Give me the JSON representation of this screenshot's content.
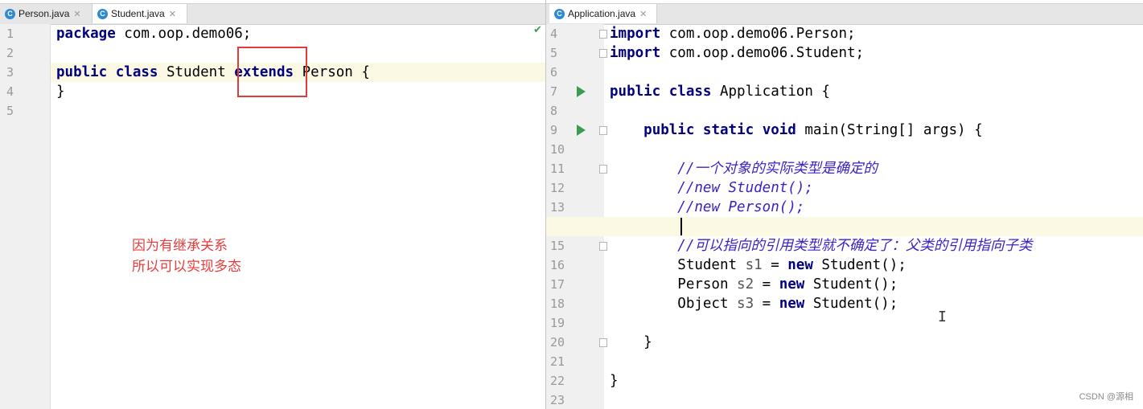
{
  "left_editor": {
    "tabs": [
      {
        "label": "Person.java",
        "icon": "C",
        "active": false
      },
      {
        "label": "Student.java",
        "icon": "C",
        "active": true
      }
    ],
    "lines": [
      {
        "num": "1",
        "parts": [
          {
            "t": "package",
            "c": "kw"
          },
          {
            "t": " com.oop.demo06;",
            "c": "code"
          }
        ]
      },
      {
        "num": "2",
        "parts": []
      },
      {
        "num": "3",
        "highlight": true,
        "parts": [
          {
            "t": "public",
            "c": "kw"
          },
          {
            "t": " ",
            "c": "code"
          },
          {
            "t": "class",
            "c": "kw"
          },
          {
            "t": " Student ",
            "c": "code"
          },
          {
            "t": "extends",
            "c": "kw"
          },
          {
            "t": " Person {",
            "c": "code"
          }
        ]
      },
      {
        "num": "4",
        "parts": [
          {
            "t": "}",
            "c": "code"
          }
        ]
      },
      {
        "num": "5",
        "parts": []
      }
    ],
    "annotation": [
      "因为有继承关系",
      "所以可以实现多态"
    ]
  },
  "right_editor": {
    "tabs": [
      {
        "label": "Application.java",
        "icon": "C",
        "active": true
      }
    ],
    "lines": [
      {
        "num": "4",
        "fold": true,
        "parts": [
          {
            "t": "import",
            "c": "kw"
          },
          {
            "t": " com.oop.demo06.Person;",
            "c": "code"
          }
        ]
      },
      {
        "num": "5",
        "fold": true,
        "parts": [
          {
            "t": "import",
            "c": "kw"
          },
          {
            "t": " com.oop.demo06.Student;",
            "c": "code"
          }
        ]
      },
      {
        "num": "6",
        "parts": []
      },
      {
        "num": "7",
        "run": true,
        "parts": [
          {
            "t": "public",
            "c": "kw"
          },
          {
            "t": " ",
            "c": "code"
          },
          {
            "t": "class",
            "c": "kw"
          },
          {
            "t": " Application {",
            "c": "code"
          }
        ]
      },
      {
        "num": "8",
        "parts": []
      },
      {
        "num": "9",
        "run": true,
        "fold": true,
        "parts": [
          {
            "t": "    ",
            "c": "code"
          },
          {
            "t": "public",
            "c": "kw"
          },
          {
            "t": " ",
            "c": "code"
          },
          {
            "t": "static",
            "c": "kw"
          },
          {
            "t": " ",
            "c": "code"
          },
          {
            "t": "void",
            "c": "kw"
          },
          {
            "t": " main(String[] args) {",
            "c": "code"
          }
        ]
      },
      {
        "num": "10",
        "parts": []
      },
      {
        "num": "11",
        "fold": true,
        "parts": [
          {
            "t": "        ",
            "c": "code"
          },
          {
            "t": "//一个对象的实际类型是确定的",
            "c": "cmt"
          }
        ]
      },
      {
        "num": "12",
        "parts": [
          {
            "t": "        ",
            "c": "code"
          },
          {
            "t": "//new Student();",
            "c": "cmt"
          }
        ]
      },
      {
        "num": "13",
        "parts": [
          {
            "t": "        ",
            "c": "code"
          },
          {
            "t": "//new Person();",
            "c": "cmt"
          }
        ]
      },
      {
        "num": "14",
        "highlight": true,
        "parts": []
      },
      {
        "num": "15",
        "fold": true,
        "parts": [
          {
            "t": "        ",
            "c": "code"
          },
          {
            "t": "//可以指向的引用类型就不确定了：父类的引用指向子类",
            "c": "cmt"
          }
        ]
      },
      {
        "num": "16",
        "parts": [
          {
            "t": "        Student ",
            "c": "code"
          },
          {
            "t": "s1",
            "c": "varn"
          },
          {
            "t": " = ",
            "c": "code"
          },
          {
            "t": "new",
            "c": "kw"
          },
          {
            "t": " Student();",
            "c": "code"
          }
        ]
      },
      {
        "num": "17",
        "parts": [
          {
            "t": "        Person ",
            "c": "code"
          },
          {
            "t": "s2",
            "c": "varn"
          },
          {
            "t": " = ",
            "c": "code"
          },
          {
            "t": "new",
            "c": "kw"
          },
          {
            "t": " Student();",
            "c": "code"
          }
        ]
      },
      {
        "num": "18",
        "parts": [
          {
            "t": "        Object ",
            "c": "code"
          },
          {
            "t": "s3",
            "c": "varn"
          },
          {
            "t": " = ",
            "c": "code"
          },
          {
            "t": "new",
            "c": "kw"
          },
          {
            "t": " Student();",
            "c": "code"
          }
        ]
      },
      {
        "num": "19",
        "parts": []
      },
      {
        "num": "20",
        "fold": true,
        "parts": [
          {
            "t": "    }",
            "c": "code"
          }
        ]
      },
      {
        "num": "21",
        "parts": []
      },
      {
        "num": "22",
        "parts": [
          {
            "t": "}",
            "c": "code"
          }
        ]
      },
      {
        "num": "23",
        "parts": []
      }
    ]
  },
  "watermark": "CSDN @源相",
  "colors": {
    "keyword": "#000080",
    "comment": "#3c1ec8",
    "annotation": "#ea3c3c",
    "current_line": "#fbf8e4"
  }
}
